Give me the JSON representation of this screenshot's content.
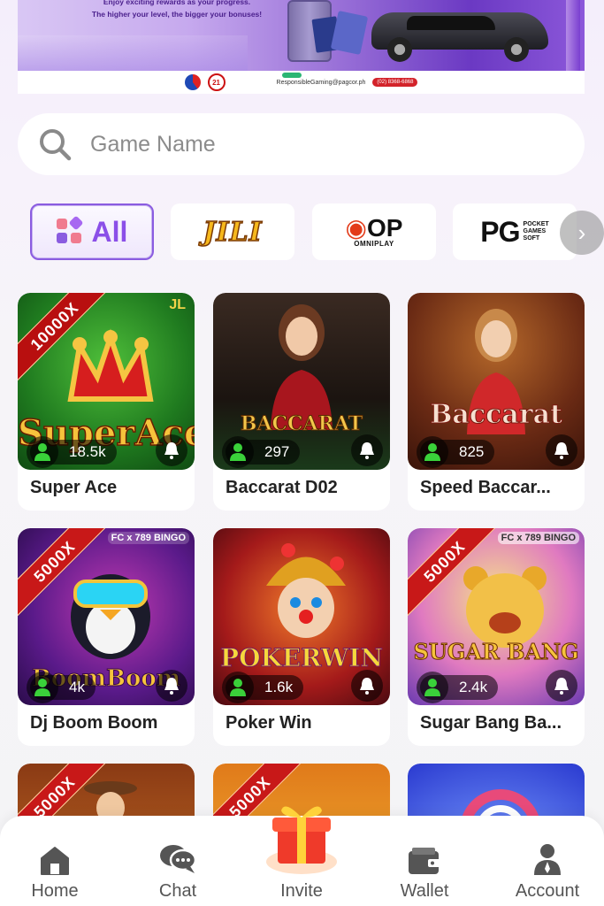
{
  "banner": {
    "line1": "Enjoy exciting rewards as your progress.",
    "line2": "The higher your level, the bigger your bonuses!",
    "email": "ResponsibleGaming@pagcor.ph",
    "hotline": "(02) 8368-6868",
    "logo2": "21"
  },
  "search": {
    "placeholder": "Game Name"
  },
  "providers": {
    "all_label": "All",
    "jili": "JILI",
    "omniplay_op": "OP",
    "omniplay_sub": "OMNIPLAY",
    "pg": "PG",
    "pg_sub": [
      "POCKET",
      "GAMES",
      "SOFT"
    ]
  },
  "games": [
    {
      "title": "Super Ace",
      "players": "18.5k",
      "badge": "10000X",
      "art": "SuperAce",
      "brand": "JL"
    },
    {
      "title": "Baccarat D02",
      "players": "297",
      "art": "BACCARAT"
    },
    {
      "title": "Speed Baccar...",
      "players": "825",
      "art": "Baccarat"
    },
    {
      "title": "Dj Boom Boom",
      "players": "4k",
      "badge": "5000X",
      "art": "BoomBoom",
      "brand": "FC x 789 BINGO"
    },
    {
      "title": "Poker Win",
      "players": "1.6k",
      "art": "POKERWIN"
    },
    {
      "title": "Sugar Bang Ba...",
      "players": "2.4k",
      "badge": "5000X",
      "art": "SUGAR BANG",
      "brand": "FC x 789 BINGO"
    },
    {
      "title": "",
      "players": "",
      "badge": "5000X"
    },
    {
      "title": "",
      "players": "",
      "badge": "5000X"
    },
    {
      "title": "",
      "players": ""
    }
  ],
  "nav": {
    "home": "Home",
    "chat": "Chat",
    "invite": "Invite",
    "wallet": "Wallet",
    "account": "Account"
  },
  "colors": {
    "accent": "#8b4fe8",
    "user_icon": "#3ad13a",
    "nav_icon": "#555555"
  }
}
